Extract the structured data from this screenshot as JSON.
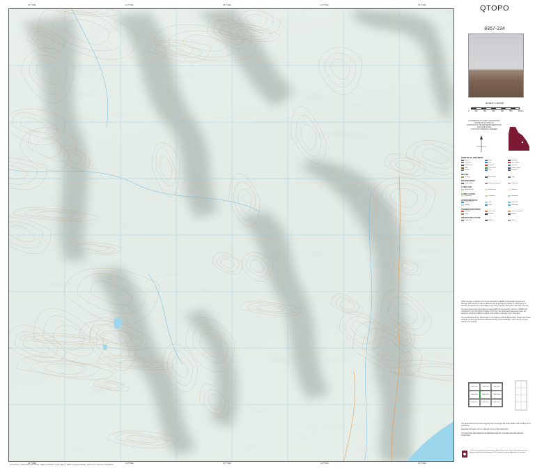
{
  "map": {
    "title": "QTOPO",
    "sheet_number": "8357-234",
    "scale": "SCALE 1:10,000",
    "scale_ticks": [
      "0",
      "100",
      "200",
      "300",
      "400",
      "500",
      "1000 m"
    ],
    "projection_lines": [
      "COORDINATE SYSTEM: GEOCENTRIC DATUM OF AUSTRALIA",
      "PROJECTION: TRANSVERSE MERCATOR",
      "MAP GRID ZONE",
      "CONTOUR INTERVAL 5 METRES"
    ],
    "edge_labels_top": [
      "147°28E",
      "147°29E",
      "147°30E",
      "147°31E",
      "147°32E"
    ],
    "edge_labels_bottom": [
      "147°28E",
      "147°29E",
      "147°30E",
      "147°31E",
      "147°32E"
    ],
    "bottom_credit": "Projection: Transverse Mercator. Map produced using data © State of Queensland. Not to be used for navigation.",
    "colors": {
      "terrain": "#e6eee9",
      "hillshade": "#8e9690",
      "grid": "#9cc8d8",
      "water": "#9cd6ec",
      "road": "#e0a060",
      "qld_maroon": "#7a1a33",
      "index_current": "#2a8f3a"
    }
  },
  "legend": {
    "sections": [
      {
        "heading": "POINTS OF INTEREST",
        "items": [
          {
            "label": "Airport",
            "color": "#666"
          },
          {
            "label": "Bore",
            "color": "#3a7bd5"
          },
          {
            "label": "Building",
            "color": "#444"
          },
          {
            "label": "Cemetery",
            "color": "#888"
          },
          {
            "label": "Dam",
            "color": "#3a7bd5"
          },
          {
            "label": "Fire station",
            "color": "#d33"
          },
          {
            "label": "Homestead",
            "color": "#555"
          },
          {
            "label": "Hospital",
            "color": "#d33"
          },
          {
            "label": "Lookout",
            "color": "#777"
          },
          {
            "label": "Mine",
            "color": "#8a5a2b"
          },
          {
            "label": "Picnic area",
            "color": "#2a8f3a"
          },
          {
            "label": "Police station",
            "color": "#2a4fa0"
          },
          {
            "label": "School",
            "color": "#777"
          },
          {
            "label": "Tank",
            "color": "#3a7bd5"
          },
          {
            "label": "Windmill",
            "color": "#555"
          }
        ]
      },
      {
        "heading": "RELIEF",
        "items": [
          {
            "label": "Contour",
            "color": "#b08a5a"
          },
          {
            "label": "Spot height",
            "color": "#555"
          },
          {
            "label": "Cliff",
            "color": "#777"
          }
        ]
      },
      {
        "heading": "BOUNDARIES",
        "items": [
          {
            "label": "State border",
            "color": "#a05a9a"
          },
          {
            "label": "Local government",
            "color": "#b77ab0"
          },
          {
            "label": "Cadastral",
            "color": "#d9a0c9"
          }
        ]
      },
      {
        "heading": "LAND USE",
        "items": [
          {
            "label": "National park",
            "color": "#b7dba0"
          },
          {
            "label": "State forest",
            "color": "#cde6b8"
          },
          {
            "label": "Reserve",
            "color": "#e2efcf"
          }
        ]
      },
      {
        "heading": "LAND COVER",
        "items": [
          {
            "label": "Vegetation",
            "color": "#d2e8c4"
          },
          {
            "label": "Plantation",
            "color": "#bcdca8"
          },
          {
            "label": "Mangrove",
            "color": "#a9d6b8"
          }
        ]
      },
      {
        "heading": "HYDROGRAPHY",
        "items": [
          {
            "label": "Watercourse",
            "color": "#3a9ad5"
          },
          {
            "label": "Lake",
            "color": "#9cd6ec"
          },
          {
            "label": "Reservoir",
            "color": "#7cc6e6"
          },
          {
            "label": "Swamp",
            "color": "#b9dfe9"
          },
          {
            "label": "Canal",
            "color": "#3a9ad5"
          },
          {
            "label": "Waterhole",
            "color": "#5ab0e0"
          }
        ]
      },
      {
        "heading": "TRANSPORTATION",
        "items": [
          {
            "label": "Highway",
            "color": "#d9534f"
          },
          {
            "label": "Main road",
            "color": "#e07a3a"
          },
          {
            "label": "Secondary road",
            "color": "#e0a060"
          },
          {
            "label": "Track",
            "color": "#a07a5a"
          },
          {
            "label": "Railway",
            "color": "#333"
          },
          {
            "label": "Bridge",
            "color": "#555"
          }
        ]
      },
      {
        "heading": "INFRASTRUCTURE",
        "items": [
          {
            "label": "Power line",
            "color": "#888"
          },
          {
            "label": "Pipeline",
            "color": "#6a6a6a"
          },
          {
            "label": "Fence",
            "color": "#999"
          }
        ]
      }
    ]
  },
  "disclaimer": [
    "QTopo has been compiled from the best information available to Queensland Government. Although effort has been made to make the map as accurate as possible, the State gives no warranty and accepts no responsibility for any loss or damage arising from reliance on this map.",
    "The Queensland Government takes no responsibility for the accuracy, currency, reliability and correctness of any information included on the map. The Queensland Government does not warrant or accept any liability in relation to the quality or accuracy of the information.",
    "The representation of any road or track is not evidence of Public Right of Way. Please note private roads do not have right of access without permission of the landholder. There may be no open access to the property."
  ],
  "index": {
    "cells": [
      "8357-133",
      "8357-233",
      "8357-333",
      "8357-134",
      "8357-234",
      "8357-334",
      "8357-131",
      "8357-231",
      "8357-331"
    ],
    "current": "8357-234"
  },
  "footer": {
    "lines": [
      "The Queensland Government supports and encourages the dissemination and exchange of its information.",
      "Metadata information can be obtained via the QTopo application.",
      "THIS MAP MAY BE PRINTED OR REPRODUCED BY ANYONE FOR NON-PROFIT PURPOSES"
    ],
    "copyright": "© State of Queensland (Department of Natural Resources, Mines, Manufacturing and Regional and Rural Development) 2025. Creative Commons Attribution 4.0 licence."
  }
}
